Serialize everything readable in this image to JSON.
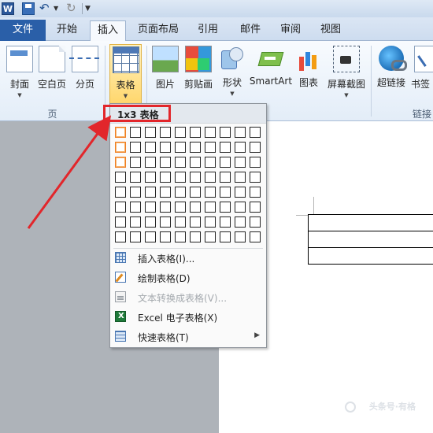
{
  "app": {
    "logo": "W"
  },
  "tabs": [
    "文件",
    "开始",
    "插入",
    "页面布局",
    "引用",
    "邮件",
    "审阅",
    "视图"
  ],
  "ribbon": {
    "buttons": [
      "封面",
      "空白页",
      "分页",
      "表格",
      "图片",
      "剪贴画",
      "形状",
      "SmartArt",
      "图表",
      "屏幕截图",
      "超链接",
      "书签"
    ],
    "groups": {
      "pages": "页",
      "links": "链接"
    }
  },
  "table_menu": {
    "header": "1x3 表格",
    "grid": {
      "cols": 10,
      "rows": 8,
      "selected_cols": 1,
      "selected_rows": 3
    },
    "items": [
      {
        "label": "插入表格(I)...",
        "icon": "table-grid-icon",
        "disabled": false
      },
      {
        "label": "绘制表格(D)",
        "icon": "pencil-icon",
        "disabled": false
      },
      {
        "label": "文本转换成表格(V)...",
        "icon": "convert-text-icon",
        "disabled": true
      },
      {
        "label": "Excel 电子表格(X)",
        "icon": "excel-icon",
        "disabled": false
      },
      {
        "label": "快速表格(T)",
        "icon": "quick-table-icon",
        "disabled": false
      }
    ]
  },
  "document": {
    "table_rows": 3
  },
  "watermark": "头条号·有格",
  "colors": {
    "callout": "#e2262b",
    "selection": "#ef7d22",
    "file_tab": "#2a5fa8"
  }
}
